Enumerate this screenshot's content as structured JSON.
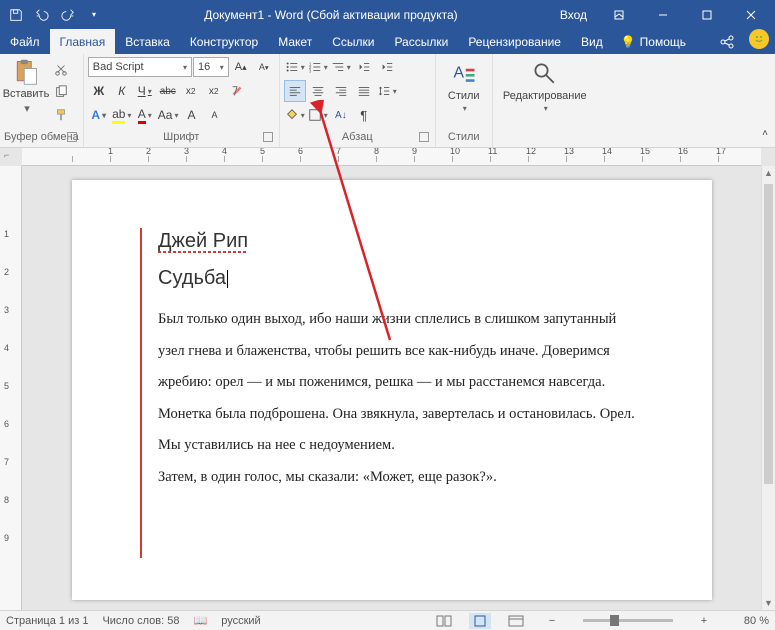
{
  "title": "Документ1  -  Word  (Сбой активации продукта)",
  "signin": "Вход",
  "tabs": {
    "file": "Файл",
    "home": "Главная",
    "insert": "Вставка",
    "design": "Конструктор",
    "layout": "Макет",
    "references": "Ссылки",
    "mailings": "Рассылки",
    "review": "Рецензирование",
    "view": "Вид",
    "help": "Помощь"
  },
  "ribbon": {
    "clipboard": {
      "paste": "Вставить",
      "label": "Буфер обмена"
    },
    "font": {
      "name": "Bad Script",
      "size": "16",
      "bold": "Ж",
      "italic": "К",
      "underline": "Ч",
      "strike": "abc",
      "label": "Шрифт"
    },
    "paragraph": {
      "label": "Абзац"
    },
    "styles": {
      "btn": "Стили",
      "label": "Стили"
    },
    "editing": {
      "btn": "Редактирование"
    }
  },
  "document": {
    "line1": "Джей Рип",
    "line2": "Судьба",
    "body": "Был только один выход, ибо наши жизни сплелись в слишком запутанный узел гнева и блаженства, чтобы решить все как-нибудь иначе. Доверимся жребию: орел — и мы поженимся, решка — и мы расстанемся навсегда. Монетка была подброшена. Она звякнула, завертелась и остановилась. Орел. Мы уставились на нее с недоумением.",
    "body2": "Затем, в один голос, мы сказали: «Может, еще разок?»."
  },
  "status": {
    "page": "Страница 1 из 1",
    "words": "Число слов: 58",
    "lang": "русский",
    "zoom": "80 %"
  },
  "ruler_h": [
    "",
    "1",
    "2",
    "3",
    "4",
    "5",
    "6",
    "7",
    "8",
    "9",
    "10",
    "11",
    "12",
    "13",
    "14",
    "15",
    "16",
    "17"
  ],
  "ruler_v": [
    "",
    "1",
    "2",
    "3",
    "4",
    "5",
    "6",
    "7",
    "8",
    "9"
  ]
}
